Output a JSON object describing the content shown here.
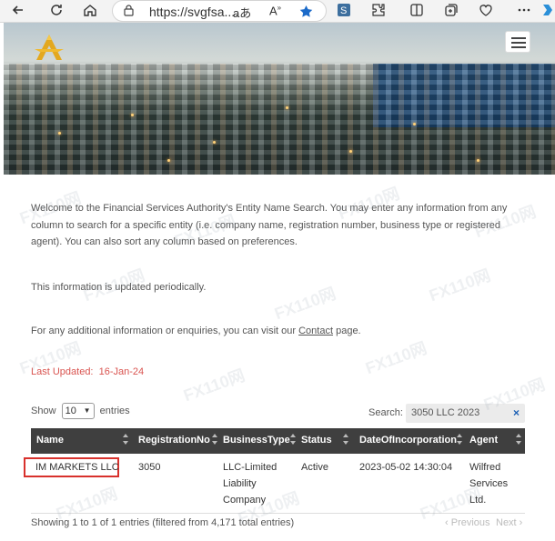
{
  "browser": {
    "url": "https://svgfsa....",
    "icons": [
      "back-icon",
      "refresh-icon",
      "home-icon",
      "lock-icon",
      "read-aloud-icon",
      "text-size-icon",
      "favorite-star-icon",
      "extension-s-icon",
      "extensions-icon",
      "split-screen-icon",
      "collections-icon",
      "performance-icon",
      "copilot-icon"
    ]
  },
  "hero": {
    "logo": "fsa-logo",
    "menu_icon": "hamburger-menu-icon"
  },
  "intro": {
    "text": "Welcome to the Financial Services Authority's Entity Name Search. You may enter any information from any column to search for a specific entity (i.e. company name, registration number, business type or registered agent). You can also sort any column based on preferences.",
    "updated_note": "This information is updated periodically.",
    "contact_prefix": "For any additional information or enquiries, you can visit our ",
    "contact_link": "Contact",
    "contact_suffix": " page."
  },
  "last_updated": {
    "label": "Last Updated:",
    "date": "16-Jan-24",
    "color": "#d9534f"
  },
  "table_controls": {
    "show_label": "Show",
    "entries_value": "10",
    "entries_label": "entries",
    "search_label": "Search:",
    "search_value": "3050 LLC 2023",
    "clear_icon": "×"
  },
  "table": {
    "columns": [
      "Name",
      "RegistrationNo",
      "BusinessType",
      "Status",
      "DateOfIncorporation",
      "Agent"
    ],
    "rows": [
      {
        "name": "IM MARKETS LLC",
        "registration_no": "3050",
        "business_type": [
          "LLC-Limited",
          "Liability",
          "Company"
        ],
        "status": "Active",
        "date": "2023-05-02 14:30:04",
        "agent": [
          "Wilfred",
          "Services",
          "Ltd."
        ]
      }
    ],
    "highlight_color": "#d8312c"
  },
  "footer": {
    "info": "Showing 1 to 1 of 1 entries (filtered from 4,171 total entries)",
    "previous": "Previous",
    "next": "Next"
  },
  "watermark": "FX110网"
}
